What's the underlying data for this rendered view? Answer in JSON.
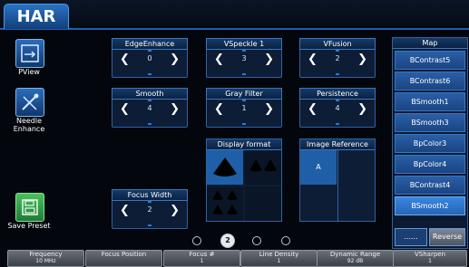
{
  "app": {
    "tab": "HAR"
  },
  "sidebar": {
    "pview": {
      "label": "PView"
    },
    "needle": {
      "label_line1": "Needle",
      "label_line2": "Enhance"
    },
    "save": {
      "label": "Save Preset"
    }
  },
  "controls": {
    "edge_enhance": {
      "title": "EdgeEnhance",
      "value": "0"
    },
    "vspeckle": {
      "title": "VSpeckle  1",
      "value": "3"
    },
    "vfusion": {
      "title": "VFusion",
      "value": "2"
    },
    "smooth": {
      "title": "Smooth",
      "value": "4"
    },
    "gray_filter": {
      "title": "Gray Filter",
      "value": "1"
    },
    "persistence": {
      "title": "Persistence",
      "value": "4"
    },
    "focus_width": {
      "title": "Focus Width",
      "value": "2"
    }
  },
  "display_format": {
    "title": "Display format"
  },
  "image_reference": {
    "title": "Image Reference",
    "selected": "A"
  },
  "map": {
    "title": "Map",
    "items": [
      "BContrast5",
      "BContrast6",
      "BSmooth1",
      "BSmooth3",
      "BpColor3",
      "BpColor4",
      "BContrast4",
      "BSmooth2"
    ],
    "selected_index": 7,
    "btn_left": "......",
    "btn_right": "Reverse"
  },
  "pagination": {
    "current": "2"
  },
  "bottom_bar": [
    {
      "name": "Frequency",
      "value": "10 MHz"
    },
    {
      "name": "Focus Position",
      "value": ""
    },
    {
      "name": "Focus #",
      "value": "1"
    },
    {
      "name": "Line Density",
      "value": "1"
    },
    {
      "name": "Dynamic Range",
      "value": "92 dB"
    },
    {
      "name": "VSharpen",
      "value": "1"
    }
  ],
  "colors": {
    "accent": "#2a72c2",
    "panel": "#0d1d36",
    "selected": "#3a86df"
  }
}
